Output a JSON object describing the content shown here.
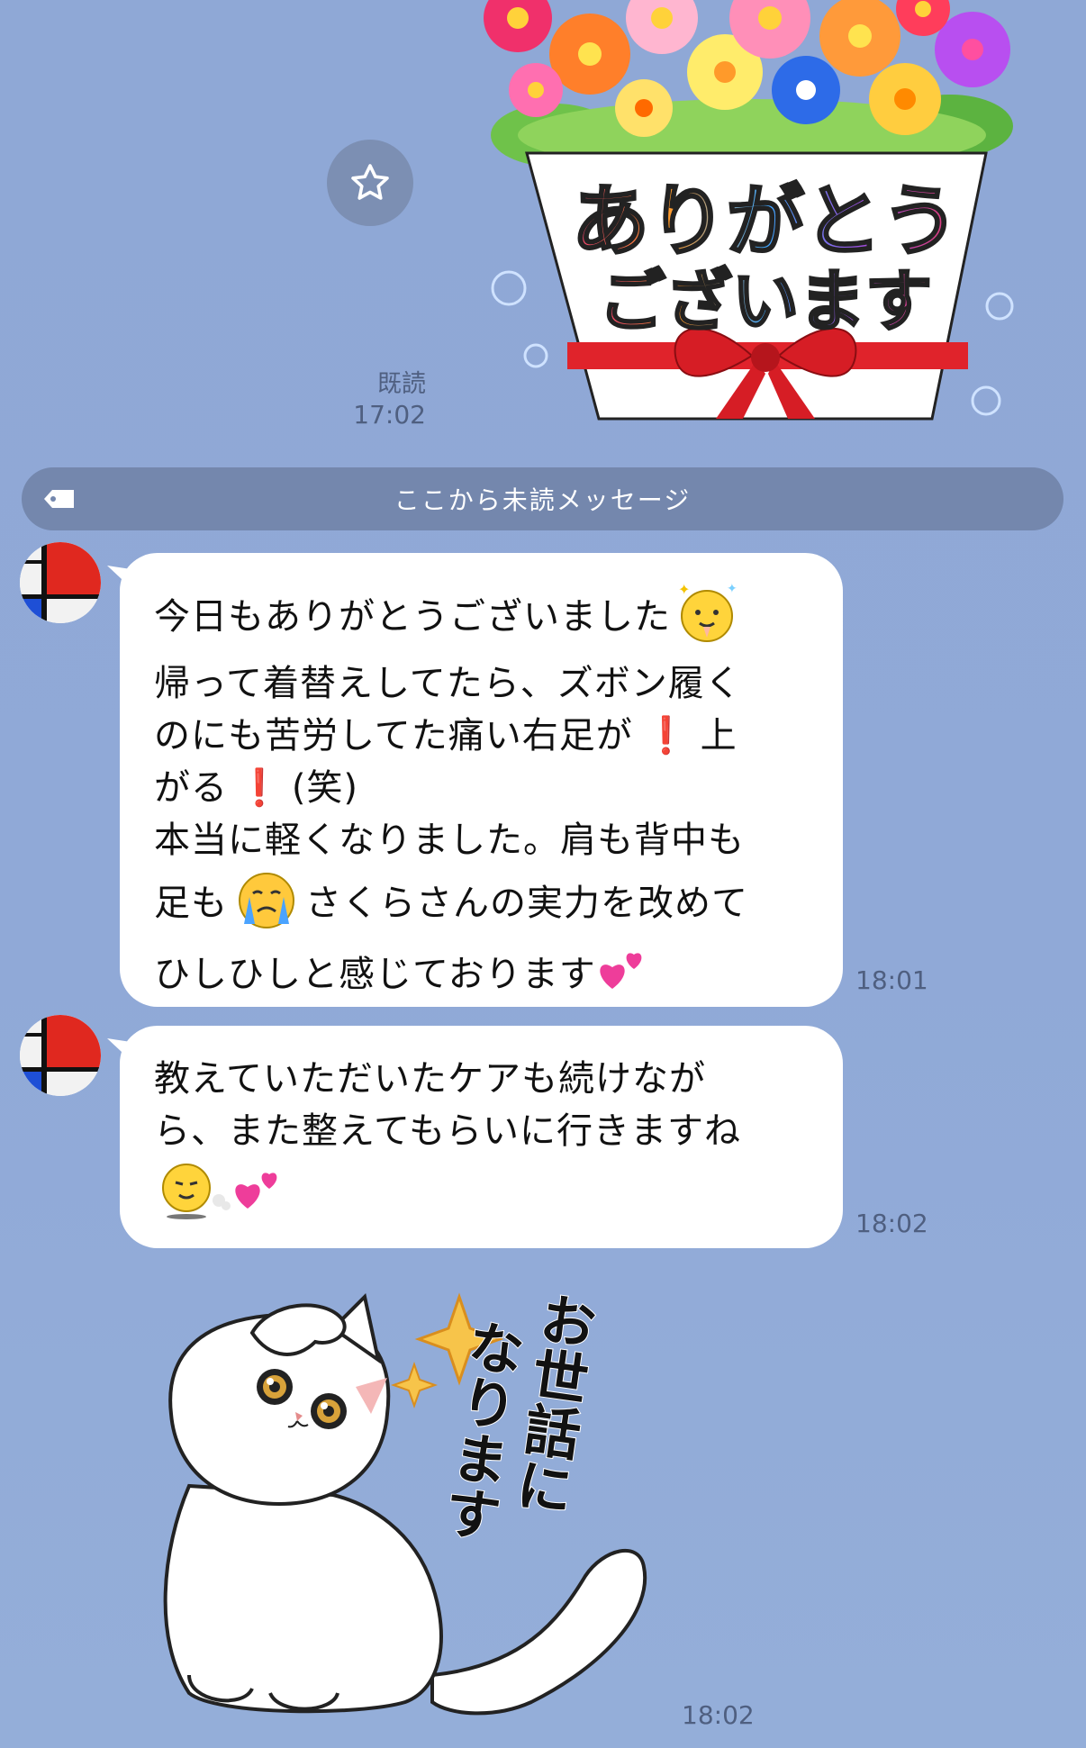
{
  "messages_top": {
    "sticker_flowers": {
      "text_line1": "ありがとう",
      "text_line2": "ございます"
    },
    "read_status": "既読",
    "read_time": "17:02"
  },
  "unread_divider": {
    "label": "ここから未読メッセージ"
  },
  "message1": {
    "lines": [
      "今日もありがとうございました",
      "帰って着替えしてたら、ズボン履く",
      "のにも苦労してた痛い右足が",
      "上",
      "がる",
      "(笑)",
      "本当に軽くなりました。肩も背中も",
      "足も",
      "さくらさんの実力を改めて",
      "ひしひしと感じております"
    ],
    "time": "18:01"
  },
  "message2": {
    "lines": [
      "教えていただいたケアも続けなが",
      "ら、また整えてもらいに行きますね"
    ],
    "time": "18:02"
  },
  "sticker_cat": {
    "text_line1": "お世話に",
    "text_line2": "なります",
    "time": "18:02"
  },
  "colors": {
    "background": "#8fa8d6",
    "bubble": "#ffffff",
    "divider": "#7487ad",
    "exclamation": "#e0232b"
  }
}
